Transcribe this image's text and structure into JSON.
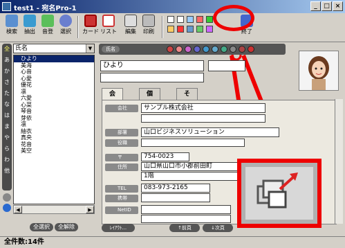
{
  "window": {
    "title": "test1 - 宛名Pro-1"
  },
  "toolbar": {
    "search": "検索",
    "extract": "抽出",
    "register": "音登",
    "select": "選択",
    "card": "カード",
    "list": "リスト",
    "edit": "編集",
    "print": "印刷",
    "exit": "終了"
  },
  "left": {
    "field_select": "氏名",
    "index_tabs": [
      "全",
      "あ",
      "か",
      "さ",
      "た",
      "な",
      "は",
      "ま",
      "や",
      "ら",
      "わ",
      "他"
    ],
    "names": [
      "ひより",
      "美海",
      "心音",
      "心愛",
      "優花",
      "凛",
      "六愛",
      "心菜",
      "琴音",
      "芽依",
      "凛",
      "紬衣",
      "真央",
      "花音",
      "美空"
    ],
    "select_all": "全選択",
    "deselect_all": "全解除"
  },
  "detail": {
    "name_label": "氏名",
    "name_value": "ひより",
    "tabs": [
      "会社",
      "個人",
      "その他"
    ],
    "company_label": "会社",
    "company_value": "サンプル株式会社",
    "dept_label": "部署",
    "dept_value": "山口ビジネスソリューション",
    "title_label": "役職",
    "zip_label": "〒",
    "zip_value": "754-0023",
    "address_label": "住所",
    "address_value": "山口県山口市小郡前田町",
    "address2_value": "1階",
    "tel_label": "TEL",
    "tel_value": "083-973-2165",
    "mobile_label": "携帯",
    "netid_label": "NetID",
    "layout_btn": "ﾚｲｱｳﾄ...",
    "prev_btn": "↑前頁",
    "next_btn": "↓次頁"
  },
  "status": {
    "count": "全件数:14件"
  },
  "colors": {
    "titlebar": "#0a246a",
    "highlight": "#e00000",
    "selected": "#0a246a"
  }
}
